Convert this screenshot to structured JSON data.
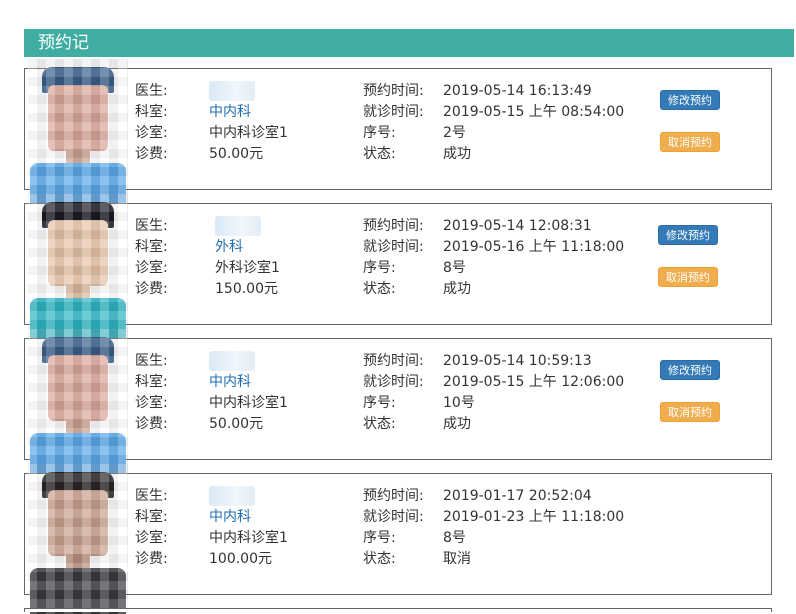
{
  "header": {
    "title": "预约记"
  },
  "labels": {
    "doctor": "医生:",
    "dept": "科室:",
    "room": "诊室:",
    "fee": "诊费:",
    "booked_time": "预约时间:",
    "visit_time": "就诊时间:",
    "number": "序号:",
    "status": "状态:"
  },
  "buttons": {
    "modify": "修改预约",
    "cancel": "取消预约"
  },
  "records": [
    {
      "dept": "中内科",
      "room": "中内科诊室1",
      "fee": "50.00元",
      "booked_time": "2019-05-14 16:13:49",
      "visit_time": "2019-05-15 上午 08:54:00",
      "number": "2号",
      "status": "成功",
      "has_buttons": true
    },
    {
      "dept": "外科",
      "room": "外科诊室1",
      "fee": "150.00元",
      "booked_time": "2019-05-14 12:08:31",
      "visit_time": "2019-05-16 上午 11:18:00",
      "number": "8号",
      "status": "成功",
      "has_buttons": true
    },
    {
      "dept": "中内科",
      "room": "中内科诊室1",
      "fee": "50.00元",
      "booked_time": "2019-05-14 10:59:13",
      "visit_time": "2019-05-15 上午 12:06:00",
      "number": "10号",
      "status": "成功",
      "has_buttons": true
    },
    {
      "dept": "中内科",
      "room": "中内科诊室1",
      "fee": "100.00元",
      "booked_time": "2019-01-17 20:52:04",
      "visit_time": "2019-01-23 上午 11:18:00",
      "number": "8号",
      "status": "取消",
      "has_buttons": false
    }
  ]
}
